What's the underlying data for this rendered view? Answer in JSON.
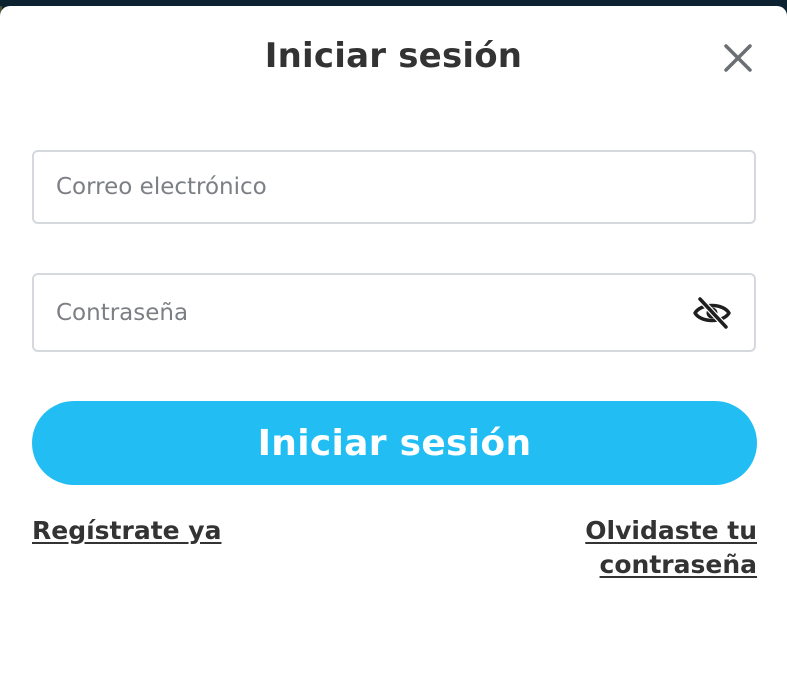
{
  "dialog": {
    "title": "Iniciar sesión",
    "close_icon": "close-icon"
  },
  "form": {
    "email_placeholder": "Correo electrónico",
    "email_value": "",
    "password_placeholder": "Contraseña",
    "password_value": "",
    "toggle_icon": "eye-slash-icon",
    "submit_label": "Iniciar sesión"
  },
  "links": {
    "register_label": "Regístrate ya",
    "forgot_label": "Olvidaste tu contraseña"
  },
  "colors": {
    "accent": "#22bef3",
    "text": "#333333",
    "border": "#d5d9dd"
  }
}
